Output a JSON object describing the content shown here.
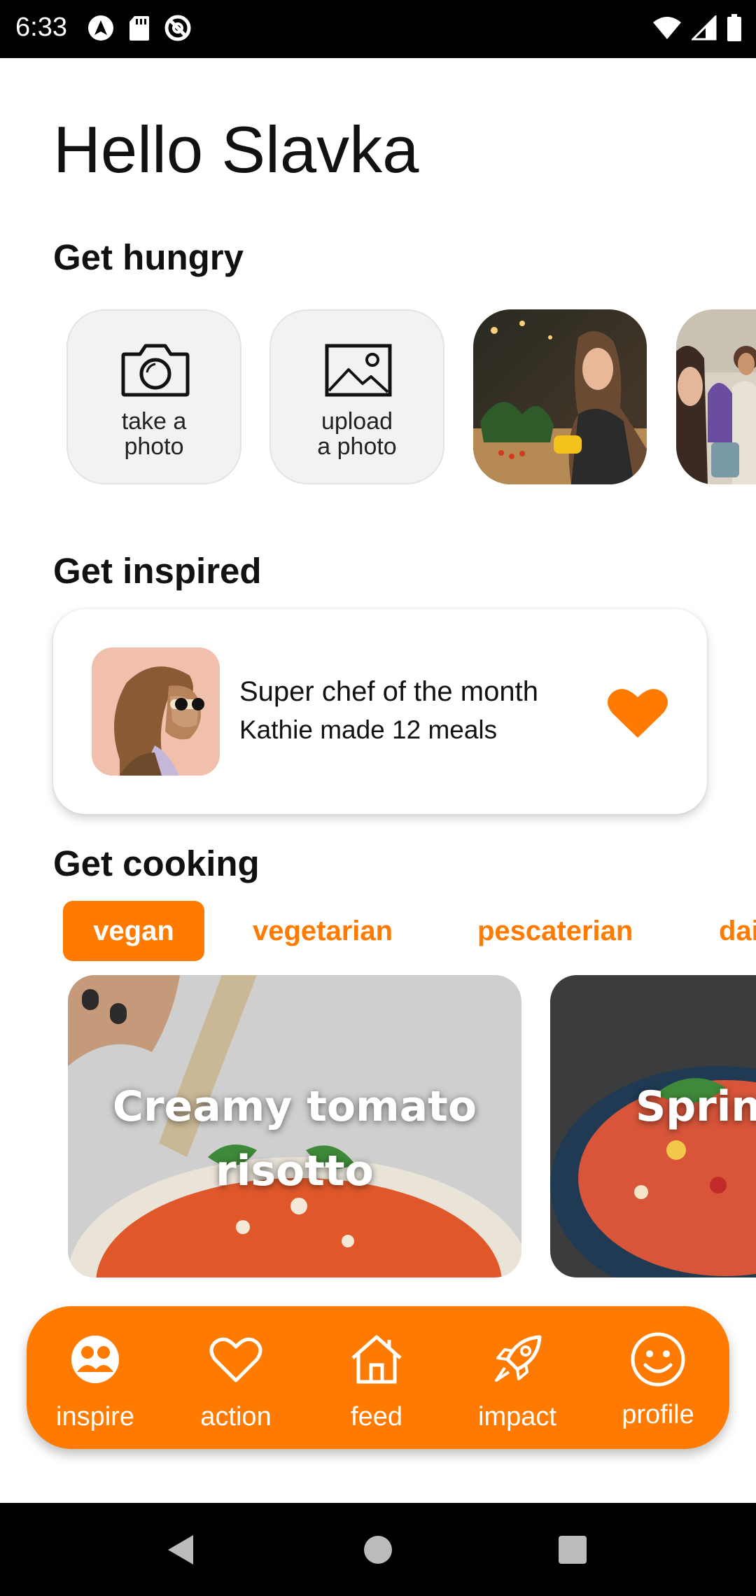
{
  "status_bar": {
    "time": "6:33",
    "left_icons": [
      "navigation-app-icon",
      "sd-card-icon",
      "vpn-blocked-icon"
    ],
    "right_icons": [
      "wifi-icon",
      "cell-signal-icon",
      "battery-icon"
    ]
  },
  "greeting": "Hello Slavka",
  "sections": {
    "hungry_title": "Get hungry",
    "inspired_title": "Get inspired",
    "cooking_title": "Get cooking"
  },
  "hungry_actions": [
    {
      "label": "take a\nphoto",
      "icon": "camera-icon"
    },
    {
      "label": "upload\na photo",
      "icon": "image-icon"
    }
  ],
  "inspire_card": {
    "title": "Super chef of the month",
    "subtitle": "Kathie made 12 meals",
    "icon": "heart-icon"
  },
  "categories": [
    "vegan",
    "vegetarian",
    "pescaterian",
    "dai"
  ],
  "recipes": [
    {
      "title_line1": "Creamy tomato",
      "title_line2": "risotto"
    },
    {
      "title_line1": "Spring",
      "title_line2": ""
    }
  ],
  "bottom_nav": [
    {
      "label": "inspire",
      "icon": "people-icon"
    },
    {
      "label": "action",
      "icon": "heart-outline-icon"
    },
    {
      "label": "feed",
      "icon": "home-icon"
    },
    {
      "label": "impact",
      "icon": "rocket-icon"
    },
    {
      "label": "profile",
      "icon": "smiley-icon"
    }
  ],
  "colors": {
    "accent": "#ff7a00",
    "tile_bg": "#f2f2f2",
    "text": "#111111"
  }
}
